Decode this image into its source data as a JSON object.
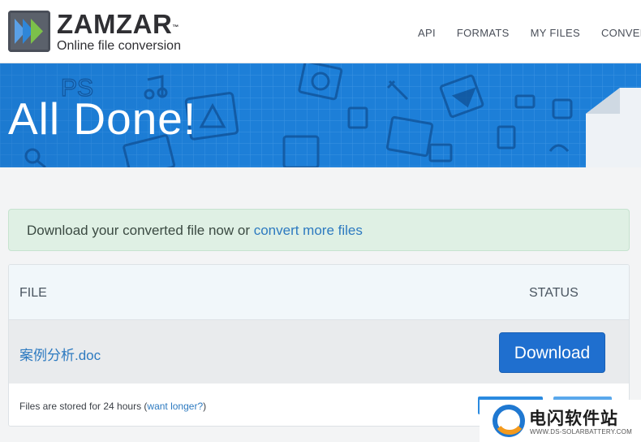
{
  "header": {
    "brand": "ZAMZAR",
    "trademark": "™",
    "tagline": "Online file conversion",
    "nav": [
      "API",
      "FORMATS",
      "MY FILES",
      "CONVERTER"
    ]
  },
  "hero": {
    "title": "All Done!"
  },
  "alert": {
    "text": "Download your converted file now or ",
    "link": "convert more files"
  },
  "table": {
    "headers": {
      "file": "FILE",
      "status": "STATUS"
    },
    "rows": [
      {
        "file_name": "案例分析.doc",
        "action": "Download"
      }
    ],
    "footer_text": "Files are stored for 24 hours (",
    "footer_link": "want longer?",
    "footer_close": ")"
  },
  "watermark": {
    "title": "电闪软件站",
    "url": "WWW.DS-SOLARBATTERY.COM"
  },
  "colors": {
    "hero_blue": "#1d7fd8",
    "button_blue": "#1f6fcf",
    "link_blue": "#2d7ac0",
    "alert_green": "#dff0e4"
  }
}
